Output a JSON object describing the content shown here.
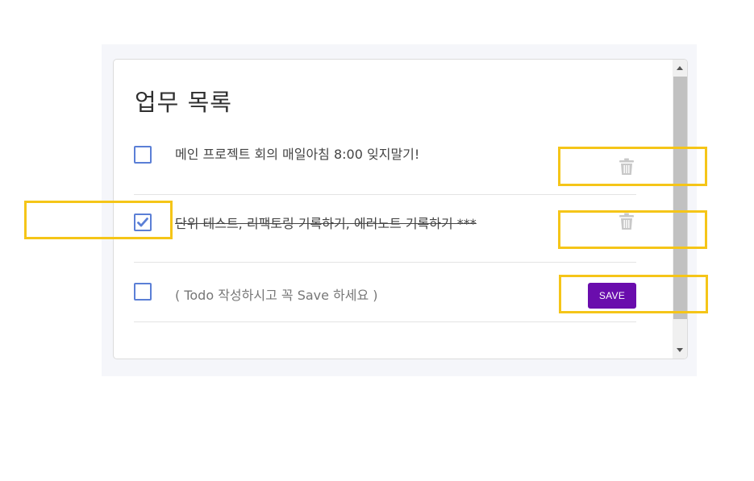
{
  "title": "업무 목록",
  "todos": [
    {
      "text": "메인 프로젝트 회의 매일아침 8:00 잊지말기!",
      "checked": false,
      "icon": "trash-icon"
    },
    {
      "text": "단위 테스트, 리팩토링 기록하기, 에러노트 기록하기 ***",
      "checked": true,
      "icon": "trash-icon"
    }
  ],
  "new_todo": {
    "placeholder": "( Todo 작성하시고 꼭 Save 하세요 )",
    "value": "",
    "save_label": "SAVE"
  },
  "colors": {
    "accent": "#6a0dad",
    "checkbox": "#5b7fd6",
    "highlight": "#f5c518",
    "trash": "#c8c8c8"
  }
}
